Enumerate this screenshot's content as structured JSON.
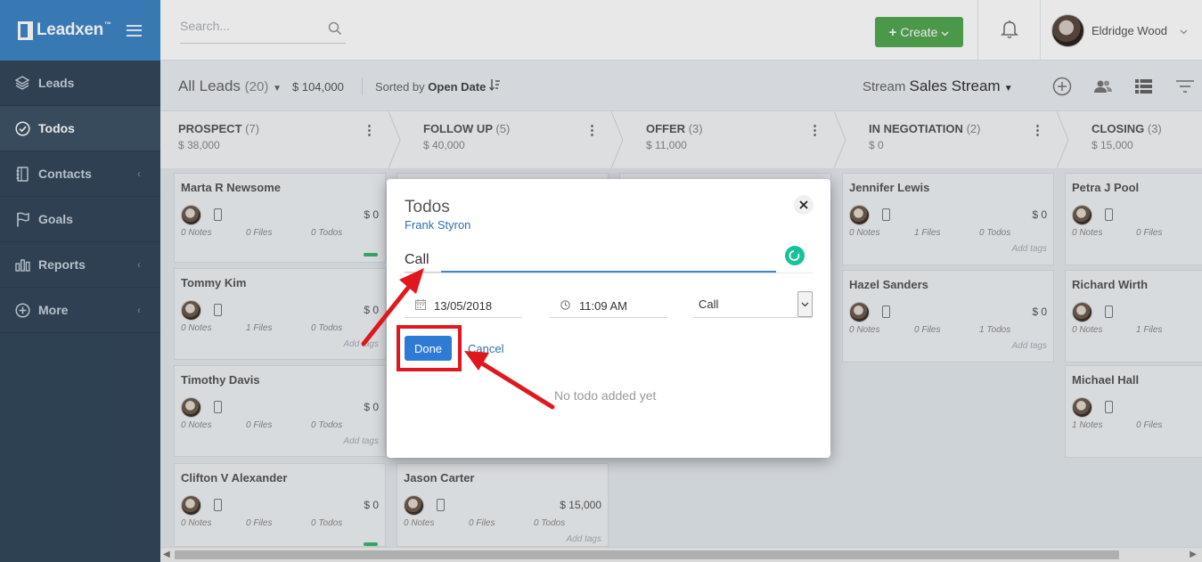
{
  "brand": {
    "name": "Leadxen",
    "tm": "™"
  },
  "sidebar": {
    "items": [
      {
        "label": "Leads",
        "active": false,
        "icon": "layers-icon",
        "chevron": false
      },
      {
        "label": "Todos",
        "active": true,
        "icon": "check-circle-icon",
        "chevron": false
      },
      {
        "label": "Contacts",
        "active": false,
        "icon": "contacts-book-icon",
        "chevron": true
      },
      {
        "label": "Goals",
        "active": false,
        "icon": "flag-icon",
        "chevron": false
      },
      {
        "label": "Reports",
        "active": false,
        "icon": "bar-chart-icon",
        "chevron": true
      },
      {
        "label": "More",
        "active": false,
        "icon": "plus-circle-icon",
        "chevron": true
      }
    ],
    "chevron_glyph": "‹"
  },
  "topbar": {
    "search_placeholder": "Search...",
    "create_label": "Create",
    "user_name": "Eldridge Wood"
  },
  "subheader": {
    "title": "All Leads",
    "count": "(20)",
    "total": "$ 104,000",
    "sorted_by_prefix": "Sorted by",
    "sorted_by_field": "Open Date",
    "stream_prefix": "Stream",
    "stream_name": "Sales Stream"
  },
  "stages": [
    {
      "name": "PROSPECT",
      "count": "(7)",
      "value": "$ 38,000"
    },
    {
      "name": "FOLLOW UP",
      "count": "(5)",
      "value": "$ 40,000"
    },
    {
      "name": "OFFER",
      "count": "(3)",
      "value": "$ 11,000"
    },
    {
      "name": "IN NEGOTIATION",
      "count": "(2)",
      "value": "$ 0"
    },
    {
      "name": "CLOSING",
      "count": "(3)",
      "value": "$ 15,000"
    }
  ],
  "cards": {
    "prospect": [
      {
        "name": "Marta R Newsome",
        "amount": "$ 0",
        "notes": "0 Notes",
        "files": "0 Files",
        "todos": "0 Todos",
        "tags": ""
      },
      {
        "name": "Tommy Kim",
        "amount": "$ 0",
        "notes": "0 Notes",
        "files": "1 Files",
        "todos": "0 Todos",
        "tags": "Add tags"
      },
      {
        "name": "Timothy Davis",
        "amount": "$ 0",
        "notes": "0 Notes",
        "files": "0 Files",
        "todos": "0 Todos",
        "tags": "Add tags"
      },
      {
        "name": "Clifton V Alexander",
        "amount": "$ 0",
        "notes": "0 Notes",
        "files": "0 Files",
        "todos": "0 Todos",
        "tags": ""
      }
    ],
    "follow_up": [
      {
        "name": "Jason Carter",
        "amount": "$ 15,000",
        "notes": "0 Notes",
        "files": "0 Files",
        "todos": "0 Todos",
        "tags": "Add tags"
      }
    ],
    "negotiation": [
      {
        "name": "Jennifer Lewis",
        "amount": "$ 0",
        "notes": "0 Notes",
        "files": "1 Files",
        "todos": "0 Todos",
        "tags": "Add tags"
      },
      {
        "name": "Hazel Sanders",
        "amount": "$ 0",
        "notes": "0 Notes",
        "files": "0 Files",
        "todos": "1 Todos",
        "tags": "Add tags"
      }
    ],
    "closing": [
      {
        "name": "Petra J Pool",
        "notes": "0 Notes",
        "files": "0 Files"
      },
      {
        "name": "Richard Wirth",
        "notes": "0 Notes",
        "files": "1 Files"
      },
      {
        "name": "Michael Hall",
        "notes": "1 Notes",
        "files": "0 Files"
      }
    ]
  },
  "modal": {
    "title": "Todos",
    "subtitle": "Frank Styron",
    "todo_value": "Call",
    "date": "13/05/2018",
    "time": "11:09 AM",
    "type_selected": "Call",
    "done_label": "Done",
    "cancel_label": "Cancel",
    "empty_message": "No todo added yet"
  },
  "colors": {
    "sidebar_bg": "#33475b",
    "brand_bg": "#3e86c6",
    "create_green": "#54a852",
    "done_blue": "#2e7bd6",
    "annotation_red": "#e0181e",
    "grammarly_green": "#15c39a"
  }
}
